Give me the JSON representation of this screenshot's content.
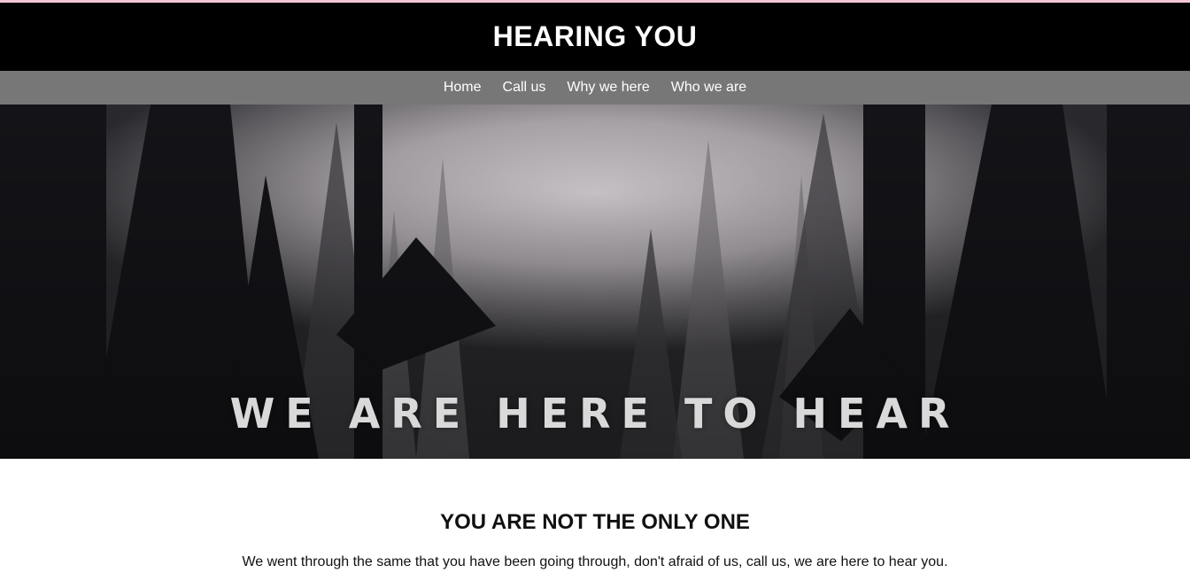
{
  "header": {
    "title": "HEARING YOU"
  },
  "nav": {
    "items": [
      {
        "label": "Home"
      },
      {
        "label": "Call us"
      },
      {
        "label": "Why we here"
      },
      {
        "label": "Who we are"
      }
    ]
  },
  "hero": {
    "tagline": "WE ARE HERE TO HEAR"
  },
  "section": {
    "title": "YOU ARE NOT THE ONLY ONE",
    "text": "We went through the same that you have been going through, don't afraid of us, call us, we are here to hear you."
  },
  "colors": {
    "accent_strip": "#f3c6d6",
    "header_bg": "#000000",
    "nav_bg": "#777777"
  }
}
